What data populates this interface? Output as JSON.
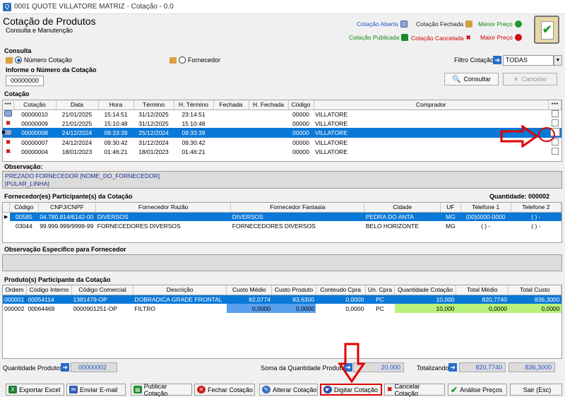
{
  "window": {
    "title": "0001 QUOTE VILLATORE MATRIZ - Cotação - 0.0"
  },
  "header": {
    "title": "Cotação de Produtos",
    "subtitle": "Consulta e Manutenção"
  },
  "legend": {
    "aberta": "Cotação Aberta",
    "fechada": "Cotação Fechada",
    "menor": "Menor Preço",
    "publicada": "Cotação Publicada",
    "cancelada": "Cotação Cancelada",
    "maior": "Maior Preço"
  },
  "consulta": {
    "label": "Consulta",
    "opt_numero": "Número Cotação",
    "opt_fornecedor": "Fornecedor",
    "filtro_label": "Filtro Cotação:",
    "filtro_value": "TODAS",
    "informe_label": "Informe o Número da Cotação",
    "numero_value": "00000000",
    "consultar": "Consultar",
    "cancelar": "Cancelar"
  },
  "cotacao": {
    "label": "Cotação",
    "columns": [
      "***",
      "Cotação",
      "Data",
      "Hora",
      "Término",
      "H. Término",
      "Fechada",
      "H. Fechada",
      "Código",
      "Comprador",
      "***"
    ],
    "rows": [
      {
        "status": "aberta",
        "cotacao": "00000010",
        "data": "21/01/2025",
        "hora": "15:14:51",
        "termino": "31/12/2025",
        "htermino": "23:14:51",
        "fechada": "",
        "hfechada": "",
        "codigo": "00000",
        "comprador": "VILLATORE"
      },
      {
        "status": "cancelada",
        "cotacao": "00000009",
        "data": "21/01/2025",
        "hora": "15:10:48",
        "termino": "31/12/2025",
        "htermino": "15:10:48",
        "fechada": "",
        "hfechada": "",
        "codigo": "00000",
        "comprador": "VILLATORE"
      },
      {
        "status": "aberta",
        "cotacao": "00000008",
        "data": "24/12/2024",
        "hora": "09:33:39",
        "termino": "25/12/2024",
        "htermino": "09:33:39",
        "fechada": "",
        "hfechada": "",
        "codigo": "00000",
        "comprador": "VILLATORE"
      },
      {
        "status": "cancelada",
        "cotacao": "00000007",
        "data": "24/12/2024",
        "hora": "09:30:42",
        "termino": "31/12/2024",
        "htermino": "09:30:42",
        "fechada": "",
        "hfechada": "",
        "codigo": "00000",
        "comprador": "VILLATORE"
      },
      {
        "status": "cancelada",
        "cotacao": "00000004",
        "data": "18/01/2023",
        "hora": "01:46:21",
        "termino": "18/01/2023",
        "htermino": "01:46:21",
        "fechada": "",
        "hfechada": "",
        "codigo": "00000",
        "comprador": "VILLATORE"
      }
    ]
  },
  "observacao": {
    "label": "Observação:",
    "line1": "PREZADO FORNECEDOR [NOME_DO_FORNECEDOR]",
    "line2": "[PULAR_LINHA]"
  },
  "fornecedores": {
    "label": "Fornecedor(es) Participante(s) da Cotação",
    "quantidade": "Quantidade: 000002",
    "columns": [
      "Código",
      "CNPJ/CNPF",
      "Fornecedor Razão",
      "Fornecedor Fantasia",
      "Cidade",
      "UF",
      "Telefone 1",
      "Telefone 2"
    ],
    "rows": [
      {
        "codigo": "00585",
        "cnpj": "04.780.814/6142-00",
        "razao": "DIVERSOS",
        "fantasia": "DIVERSOS",
        "cidade": "PEDRA DO ANTA",
        "uf": "MG",
        "tel1": "(00)0000-0000",
        "tel2": "(  )    -"
      },
      {
        "codigo": "03044",
        "cnpj": "99.999.999/9999-99",
        "razao": "FORNECEDORES DIVERSOS",
        "fantasia": "FORNECEDORES DIVERSOS",
        "cidade": "BELO HORIZONTE",
        "uf": "MG",
        "tel1": "(  )    -",
        "tel2": "(  )    -"
      }
    ]
  },
  "obs_fornecedor": {
    "label": "Observação Específico para Fornecedor"
  },
  "produtos": {
    "label": "Produto(s) Participante da Cotação",
    "columns": [
      "Ordem",
      "Código Interno",
      "Código Comercial",
      "Descrição",
      "Custo Médio",
      "Custo Produto",
      "Conteudo Cpra",
      "Un. Cpra",
      "Quantidade Cotação",
      "Total Médio",
      "Total Custo"
    ],
    "rows": [
      {
        "ordem": "000001",
        "interno": "00054114",
        "comercial": "1381479-OP",
        "descricao": "DOBRADICA GRADE FRONTAL",
        "custo_medio": "82,0774",
        "custo_produto": "83,6300",
        "conteudo": "0,0000",
        "un": "PC",
        "qtd": "10,000",
        "total_medio": "820,7740",
        "total_custo": "836,3000"
      },
      {
        "ordem": "000002",
        "interno": "00064469",
        "comercial": "0000901251-OP",
        "descricao": "FILTRO",
        "custo_medio": "0,0000",
        "custo_produto": "0,0000",
        "conteudo": "0,0000",
        "un": "PC",
        "qtd": "10,000",
        "total_medio": "0,0000",
        "total_custo": "0,0000"
      }
    ]
  },
  "totals": {
    "qtd_label": "Quantidade Produtos:",
    "qtd_value": "00000002",
    "soma_label": "Soma da Quantidade Produtos",
    "soma_value": "20,000",
    "totalizando_label": "Totalizando",
    "total_medio": "820,7740",
    "total_custo": "836,3000"
  },
  "buttons": {
    "exportar": "Exportar Excel",
    "enviar": "Enviar E-mail",
    "publicar": "Publicar Cotação",
    "fechar": "Fechar Cotação",
    "alterar": "Alterar Cotação",
    "digitar": "Digitar Cotação",
    "cancelar": "Cancelar Cotação",
    "analise": "Análise Preços",
    "sair": "Sair (Esc)"
  },
  "colors": {
    "selection": "#0a78d7",
    "highlight_red": "#e00000",
    "green_cell": "#b8f27a",
    "blue_cell": "#5aa0ee"
  }
}
